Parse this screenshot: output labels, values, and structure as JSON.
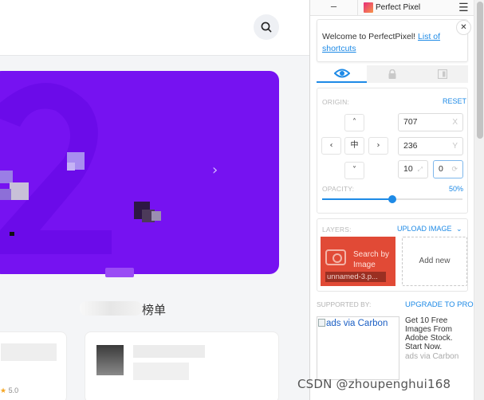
{
  "page": {
    "section_title_visible": "榜单",
    "rating": "5.0"
  },
  "extension": {
    "title": "Perfect Pixel",
    "minimize_label": "–",
    "welcome_text": "Welcome to PerfectPixel! ",
    "welcome_link": "List of shortcuts",
    "origin_label": "ORIGIN:",
    "reset_label": "RESET",
    "x_value": "707",
    "x_unit": "X",
    "y_value": "236",
    "y_unit": "Y",
    "scale_value": "10",
    "rotation_value": "0",
    "center_label": "中",
    "opacity_label": "OPACITY:",
    "opacity_value": "50%",
    "opacity_fraction": 0.5,
    "layers_label": "LAYERS:",
    "upload_label": "UPLOAD IMAGE",
    "search_image_label": "Search by Image",
    "layer_filename": "unnamed-3.p...",
    "add_new_label": "Add new",
    "supported_by_label": "SUPPORTED BY:",
    "upgrade_label": "UPGRADE TO PRO",
    "carbon_alt": "ads via Carbon",
    "carbon_text": "Get 10 Free Images From Adobe Stock. Start Now.",
    "carbon_via": "ads via Carbon"
  },
  "watermark": "CSDN @zhoupenghui168",
  "colors": {
    "banner": "#7612f1",
    "accent": "#1e8ae6",
    "layer_red": "#e14a36"
  }
}
